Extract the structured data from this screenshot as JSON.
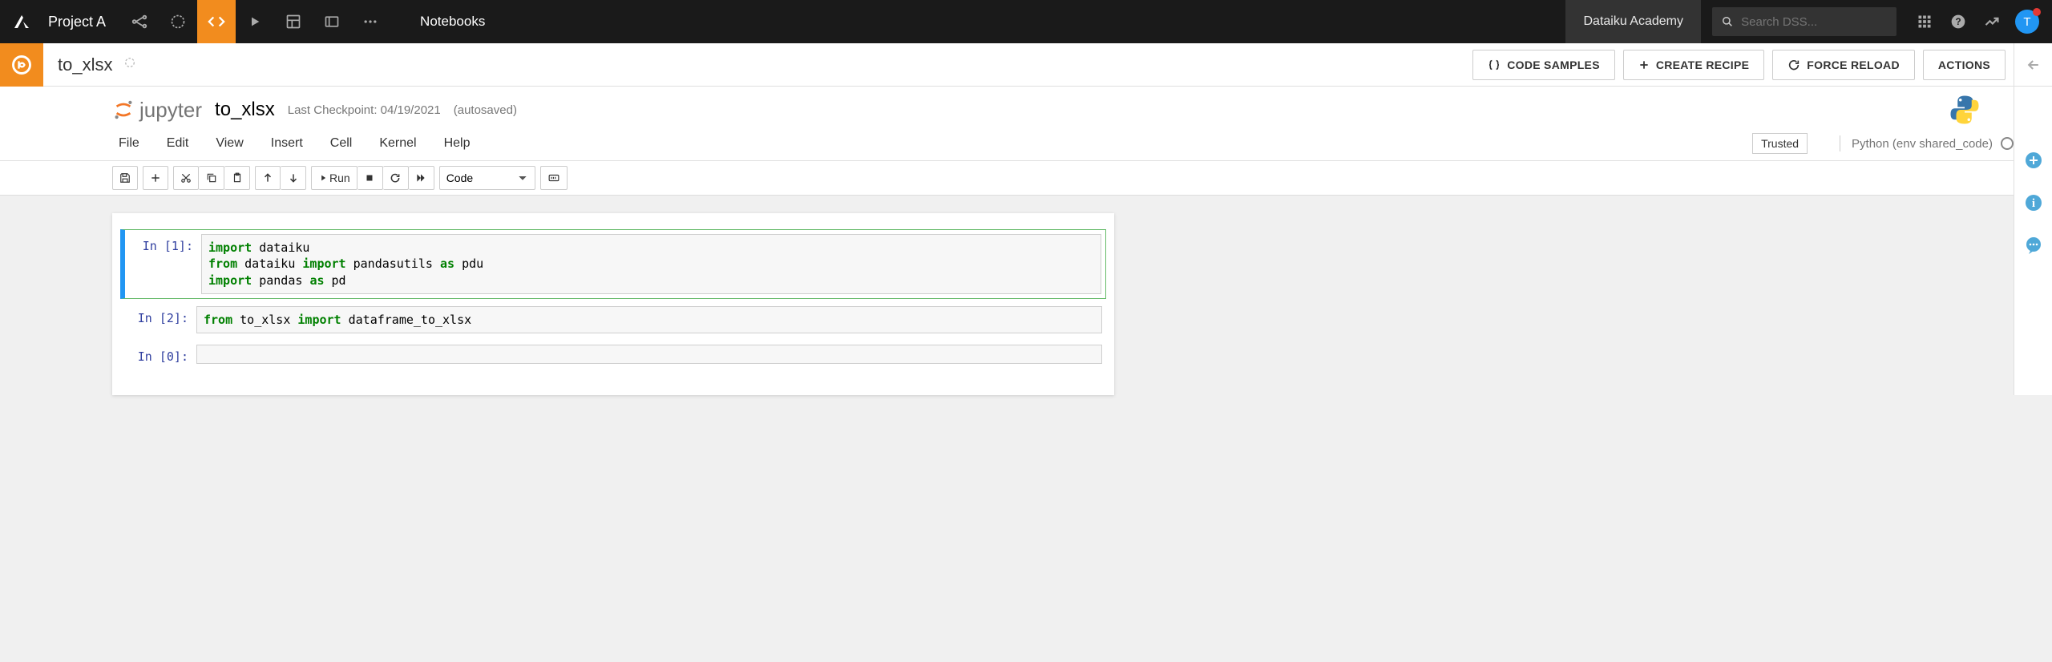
{
  "topNav": {
    "projectName": "Project A",
    "sectionLabel": "Notebooks",
    "academy": "Dataiku Academy",
    "searchPlaceholder": "Search DSS...",
    "avatarInitial": "T"
  },
  "subBar": {
    "title": "to_xlsx",
    "buttons": {
      "codeSamples": "CODE SAMPLES",
      "createRecipe": "CREATE RECIPE",
      "forceReload": "FORCE RELOAD",
      "actions": "ACTIONS"
    }
  },
  "jupyter": {
    "logoText": "jupyter",
    "notebookTitle": "to_xlsx",
    "checkpoint": "Last Checkpoint: 04/19/2021",
    "autosave": "(autosaved)",
    "menus": [
      "File",
      "Edit",
      "View",
      "Insert",
      "Cell",
      "Kernel",
      "Help"
    ],
    "trusted": "Trusted",
    "kernelName": "Python (env shared_code)",
    "toolbar": {
      "run": "Run",
      "cellTypeSelected": "Code"
    }
  },
  "cells": [
    {
      "prompt": "In [1]:",
      "lines": [
        {
          "tokens": [
            {
              "t": "import",
              "c": "kw"
            },
            {
              "t": " dataiku",
              "c": "nm"
            }
          ]
        },
        {
          "tokens": [
            {
              "t": "from",
              "c": "kw"
            },
            {
              "t": " dataiku ",
              "c": "nm"
            },
            {
              "t": "import",
              "c": "kw"
            },
            {
              "t": " pandasutils ",
              "c": "nm"
            },
            {
              "t": "as",
              "c": "kw"
            },
            {
              "t": " pdu",
              "c": "nm"
            }
          ]
        },
        {
          "tokens": [
            {
              "t": "import",
              "c": "kw"
            },
            {
              "t": " pandas ",
              "c": "nm"
            },
            {
              "t": "as",
              "c": "kw"
            },
            {
              "t": " pd",
              "c": "nm"
            }
          ]
        }
      ],
      "selected": true
    },
    {
      "prompt": "In [2]:",
      "lines": [
        {
          "tokens": [
            {
              "t": "from",
              "c": "kw"
            },
            {
              "t": " to_xlsx ",
              "c": "nm"
            },
            {
              "t": "import",
              "c": "kw"
            },
            {
              "t": " dataframe_to_xlsx",
              "c": "nm"
            }
          ]
        }
      ],
      "selected": false
    },
    {
      "prompt": "In [0]:",
      "lines": [
        {
          "tokens": [
            {
              "t": "",
              "c": "nm"
            }
          ]
        }
      ],
      "selected": false
    }
  ]
}
